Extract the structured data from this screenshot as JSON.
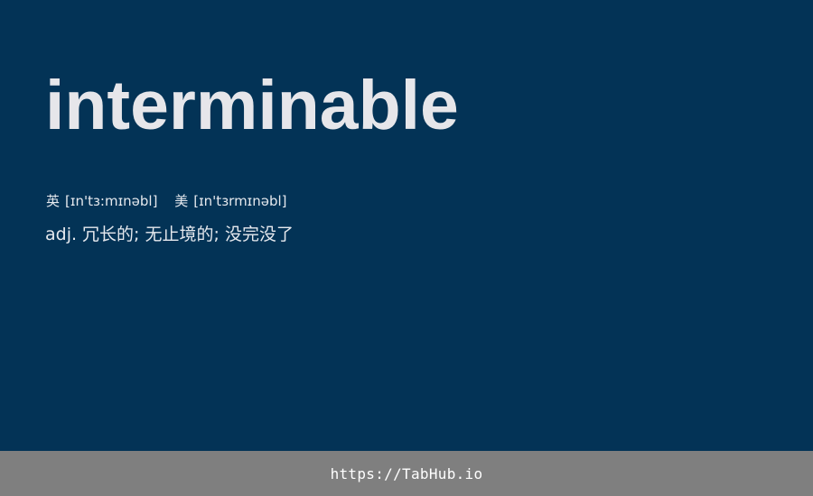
{
  "entry": {
    "word": "interminable",
    "phonetics": {
      "uk": {
        "tag": "英",
        "ipa": "[ɪn'tɜ:mɪnəbl]"
      },
      "us": {
        "tag": "美",
        "ipa": "[ɪn'tɜrmɪnəbl]"
      }
    },
    "definition": "adj. 冗长的; 无止境的; 没完没了"
  },
  "footer": {
    "link_text": "https://TabHub.io"
  },
  "colors": {
    "background": "#033356",
    "word_text": "#e6e6ea",
    "footer_background": "#7f7f7f",
    "footer_text": "#ffffff"
  }
}
